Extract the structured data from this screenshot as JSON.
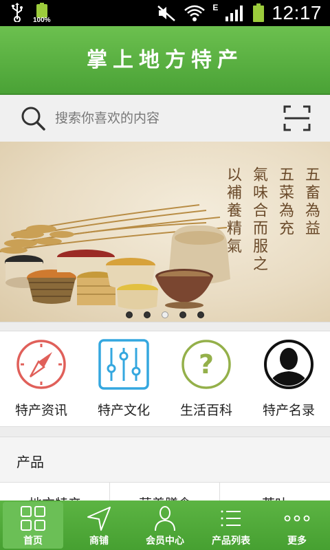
{
  "status_bar": {
    "battery_percent": "100%",
    "time": "12:17",
    "network_type": "E",
    "icons": [
      "usb-icon",
      "battery-icon",
      "mute-icon",
      "wifi-icon",
      "signal-icon",
      "battery-icon"
    ]
  },
  "header": {
    "title": "掌上地方特产"
  },
  "search": {
    "placeholder": "搜索你喜欢的内容",
    "icon": "search-icon",
    "scan_icon": "scan-icon"
  },
  "banner": {
    "poem_columns": [
      "五畜為益",
      "五菜為充",
      "氣味合而服之",
      "以補養精氣"
    ],
    "page_count": 5,
    "active_index": 2
  },
  "quick_links": [
    {
      "label": "特产资讯",
      "icon": "compass-icon",
      "color": "#e0605a"
    },
    {
      "label": "特产文化",
      "icon": "sliders-icon",
      "color": "#34a7df"
    },
    {
      "label": "生活百科",
      "icon": "question-icon",
      "color": "#94b04a"
    },
    {
      "label": "特产名录",
      "icon": "person-icon",
      "color": "#111111"
    }
  ],
  "products_section": {
    "title": "产品",
    "tabs": [
      "地方特产",
      "营养膳食",
      "茶叶"
    ]
  },
  "bottom_nav": [
    {
      "label": "首页",
      "icon": "grid-icon",
      "active": true
    },
    {
      "label": "商铺",
      "icon": "navigation-icon",
      "active": false
    },
    {
      "label": "会员中心",
      "icon": "user-icon",
      "active": false
    },
    {
      "label": "产品列表",
      "icon": "list-icon",
      "active": false
    },
    {
      "label": "更多",
      "icon": "more-icon",
      "active": false
    }
  ],
  "colors": {
    "brand_green": "#4aa236",
    "nav_green": "#5cb443"
  }
}
